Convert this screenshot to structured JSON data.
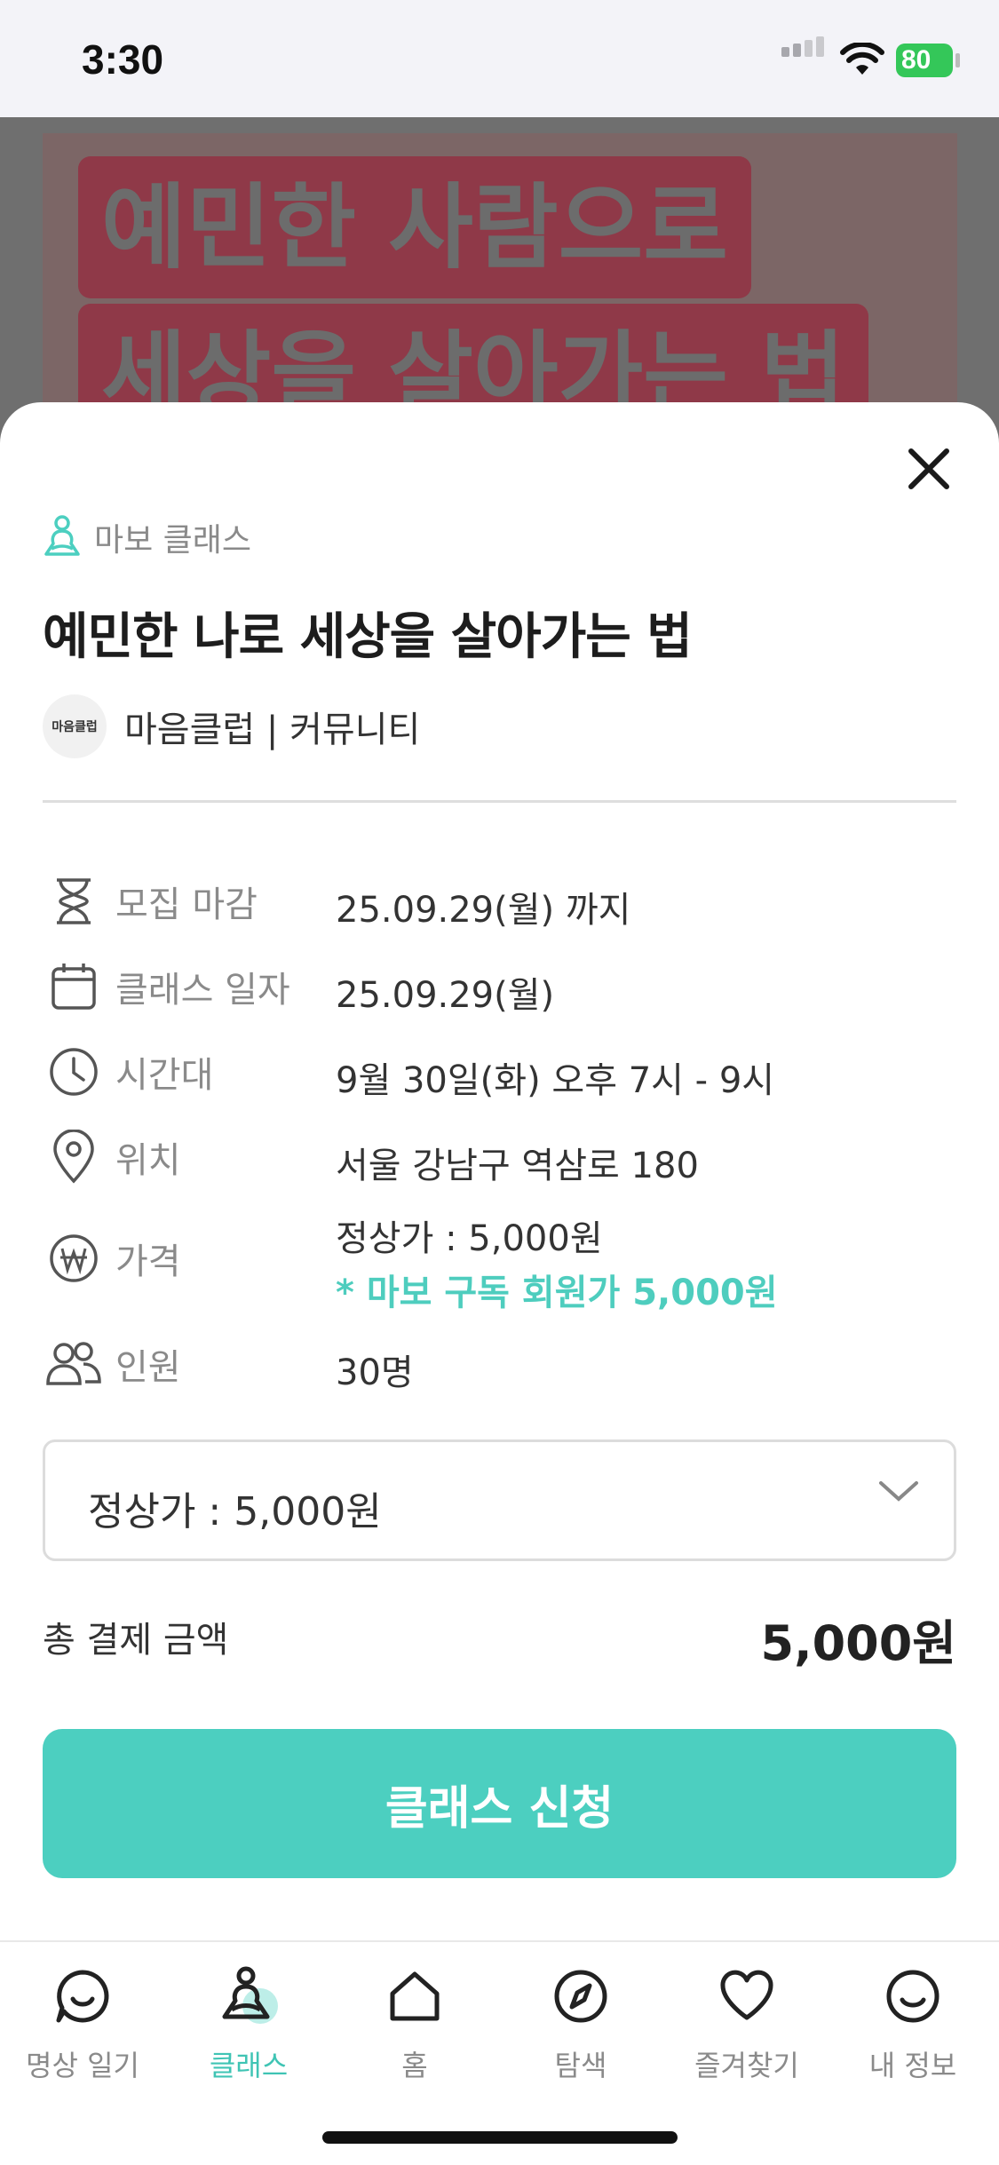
{
  "status_bar": {
    "time": "3:30",
    "battery": "80"
  },
  "banner": {
    "line1": "예민한 사람으로",
    "line2": "세상을 살아가는 법"
  },
  "sheet": {
    "category": "마보 클래스",
    "title": "예민한 나로 세상을 살아가는 법",
    "host": {
      "avatar_text": "마음클럽",
      "name": "마음클럽 | 커뮤니티"
    },
    "info": {
      "deadline": {
        "icon": "hourglass-icon",
        "label": "모집 마감",
        "value": "25.09.29(월) 까지"
      },
      "class_date": {
        "icon": "calendar-icon",
        "label": "클래스 일자",
        "value": "25.09.29(월)"
      },
      "time": {
        "icon": "clock-icon",
        "label": "시간대",
        "value": "9월 30일(화) 오후 7시 - 9시"
      },
      "location": {
        "icon": "location-pin-icon",
        "label": "위치",
        "value": "서울 강남구 역삼로 180"
      },
      "price": {
        "icon": "won-icon",
        "label": "가격",
        "value": "정상가 : 5,000원",
        "member_price": "* 마보 구독 회원가 5,000원"
      },
      "people": {
        "icon": "people-icon",
        "label": "인원",
        "value": "30명"
      }
    },
    "price_select": {
      "selected": "정상가 : 5,000원"
    },
    "total": {
      "label": "총 결제 금액",
      "amount": "5,000원"
    },
    "apply_button": "클래스 신청"
  },
  "tab_bar": {
    "items": [
      {
        "label": "명상 일기",
        "icon": "chat-smile-icon",
        "active": false
      },
      {
        "label": "클래스",
        "icon": "meditation-person-icon",
        "active": true
      },
      {
        "label": "홈",
        "icon": "home-icon",
        "active": false
      },
      {
        "label": "탐색",
        "icon": "compass-icon",
        "active": false
      },
      {
        "label": "즐겨찾기",
        "icon": "heart-icon",
        "active": false
      },
      {
        "label": "내 정보",
        "icon": "smile-profile-icon",
        "active": false
      }
    ]
  },
  "colors": {
    "accent": "#4ccfc0",
    "text_primary": "#1d1d1d",
    "text_secondary": "#8a8a8a"
  }
}
